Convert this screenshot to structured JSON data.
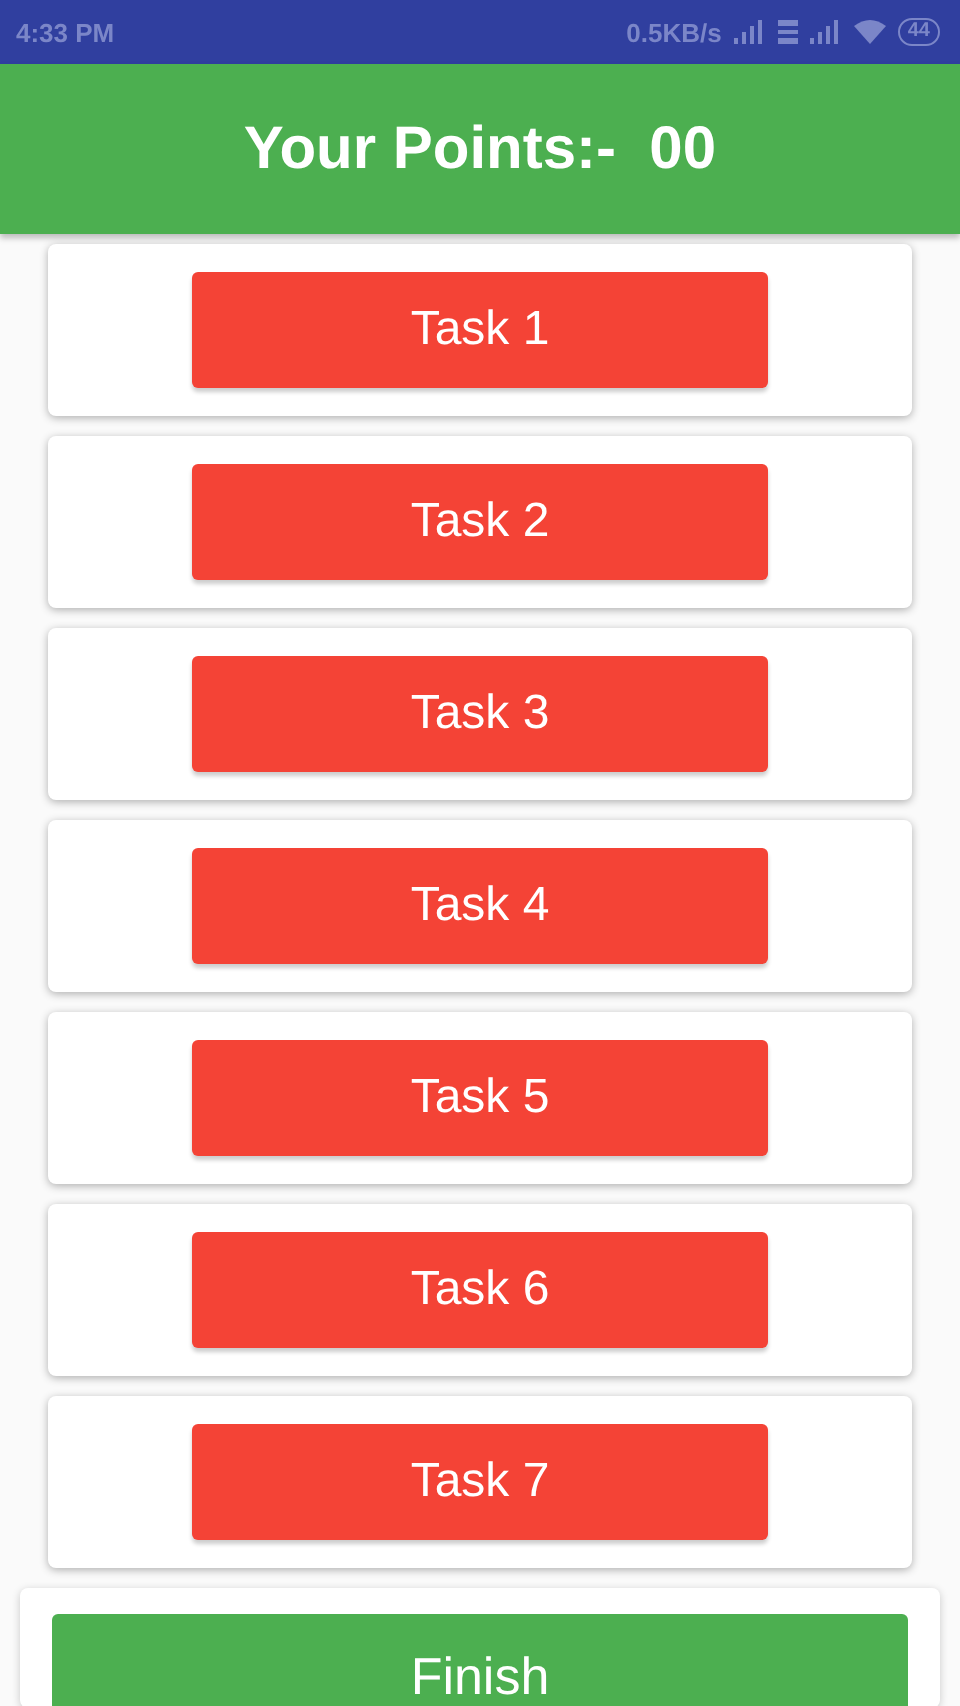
{
  "status_bar": {
    "time": "4:33 PM",
    "speed": "0.5KB/s",
    "battery": "44"
  },
  "header": {
    "title": "Your Points:-  00"
  },
  "tasks": [
    {
      "label": "Task 1"
    },
    {
      "label": "Task 2"
    },
    {
      "label": "Task 3"
    },
    {
      "label": "Task 4"
    },
    {
      "label": "Task 5"
    },
    {
      "label": "Task 6"
    },
    {
      "label": "Task 7"
    }
  ],
  "finish_button": {
    "label": "Finish"
  }
}
